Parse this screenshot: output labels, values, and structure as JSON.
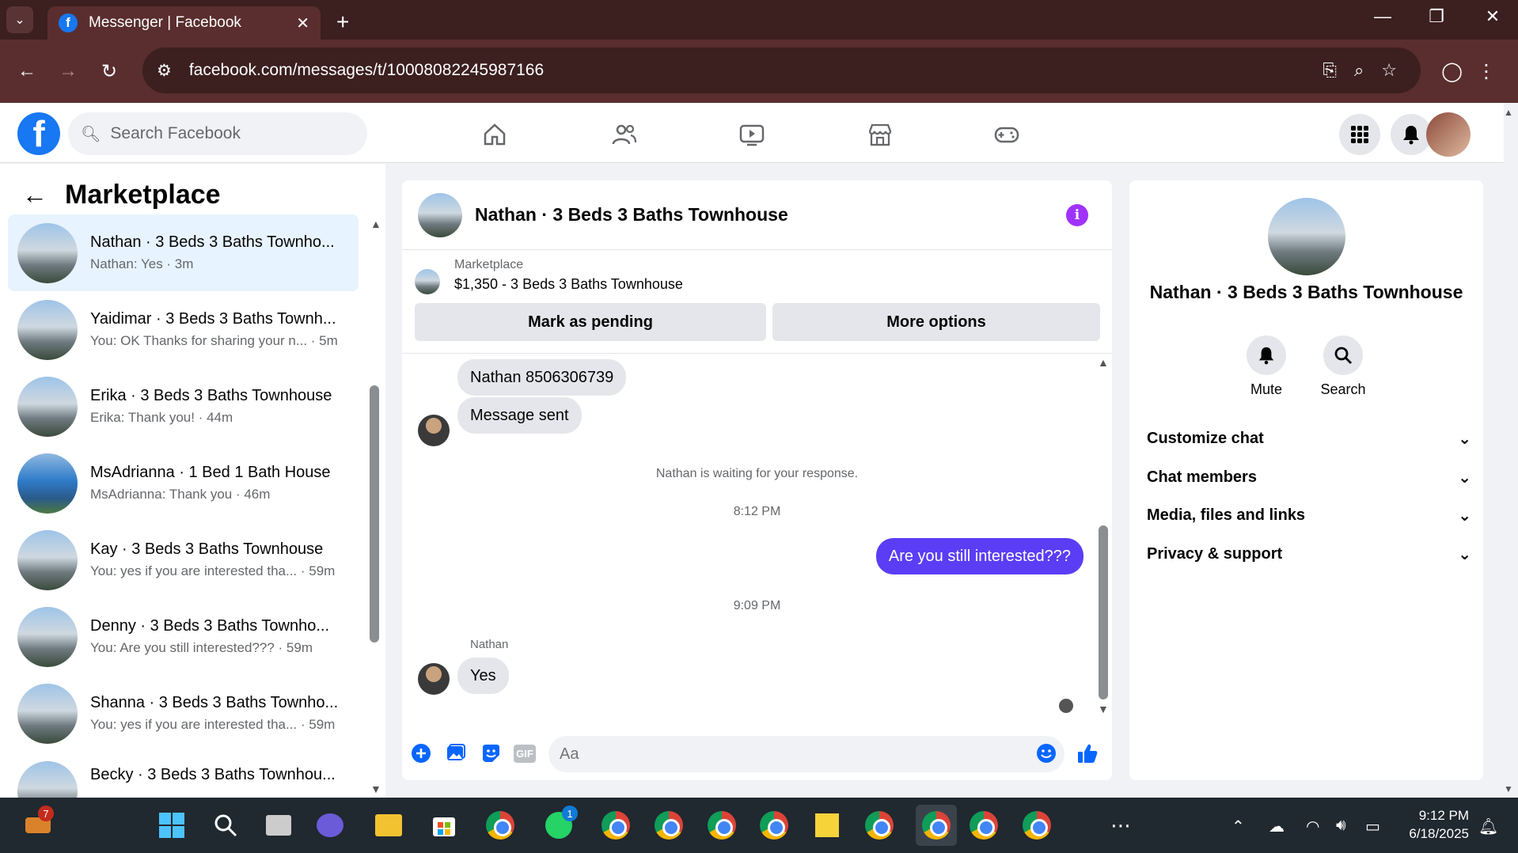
{
  "browser": {
    "tab_title": "Messenger | Facebook",
    "url": "facebook.com/messages/t/10008082245987166"
  },
  "fb_header": {
    "search_placeholder": "Search Facebook"
  },
  "left": {
    "title": "Marketplace",
    "conversations": [
      {
        "name": "Nathan · 3 Beds 3 Baths Townho...",
        "last": "Nathan: Yes · 3m",
        "active": true
      },
      {
        "name": "Yaidimar · 3 Beds 3 Baths Townh...",
        "last": "You: OK Thanks for sharing your n... · 5m"
      },
      {
        "name": "Erika · 3 Beds 3 Baths Townhouse",
        "last": "Erika: Thank you! · 44m"
      },
      {
        "name": "MsAdrianna · 1 Bed 1 Bath House",
        "last": "MsAdrianna: Thank you · 46m"
      },
      {
        "name": "Kay · 3 Beds 3 Baths Townhouse",
        "last": "You: yes if you are interested tha... · 59m"
      },
      {
        "name": "Denny · 3 Beds 3 Baths Townho...",
        "last": "You: Are you still interested??? · 59m"
      },
      {
        "name": "Shanna · 3 Beds 3 Baths Townho...",
        "last": "You: yes if you are interested tha... · 59m"
      },
      {
        "name": "Becky · 3 Beds 3 Baths Townhou...",
        "last": ""
      }
    ]
  },
  "chat": {
    "title": "Nathan · 3 Beds 3 Baths Townhouse",
    "marketplace_label": "Marketplace",
    "listing": "$1,350 - 3 Beds 3 Baths Townhouse",
    "mark_pending": "Mark as pending",
    "more_options": "More options",
    "messages": {
      "m1": "Nathan 8506306739",
      "m2": "Message sent",
      "sys_waiting": "Nathan is waiting for your response.",
      "time1": "8:12 PM",
      "m3": "Are you still interested???",
      "time2": "9:09 PM",
      "sender": "Nathan",
      "m4": "Yes"
    },
    "composer_placeholder": "Aa",
    "gif_label": "GIF"
  },
  "right": {
    "title": "Nathan · 3 Beds 3 Baths Townhouse",
    "mute": "Mute",
    "search": "Search",
    "sections": [
      "Customize chat",
      "Chat members",
      "Media, files and links",
      "Privacy & support"
    ]
  },
  "taskbar": {
    "time": "9:12 PM",
    "date": "6/18/2025",
    "badge_weather": "7",
    "badge_whatsapp": "1"
  }
}
